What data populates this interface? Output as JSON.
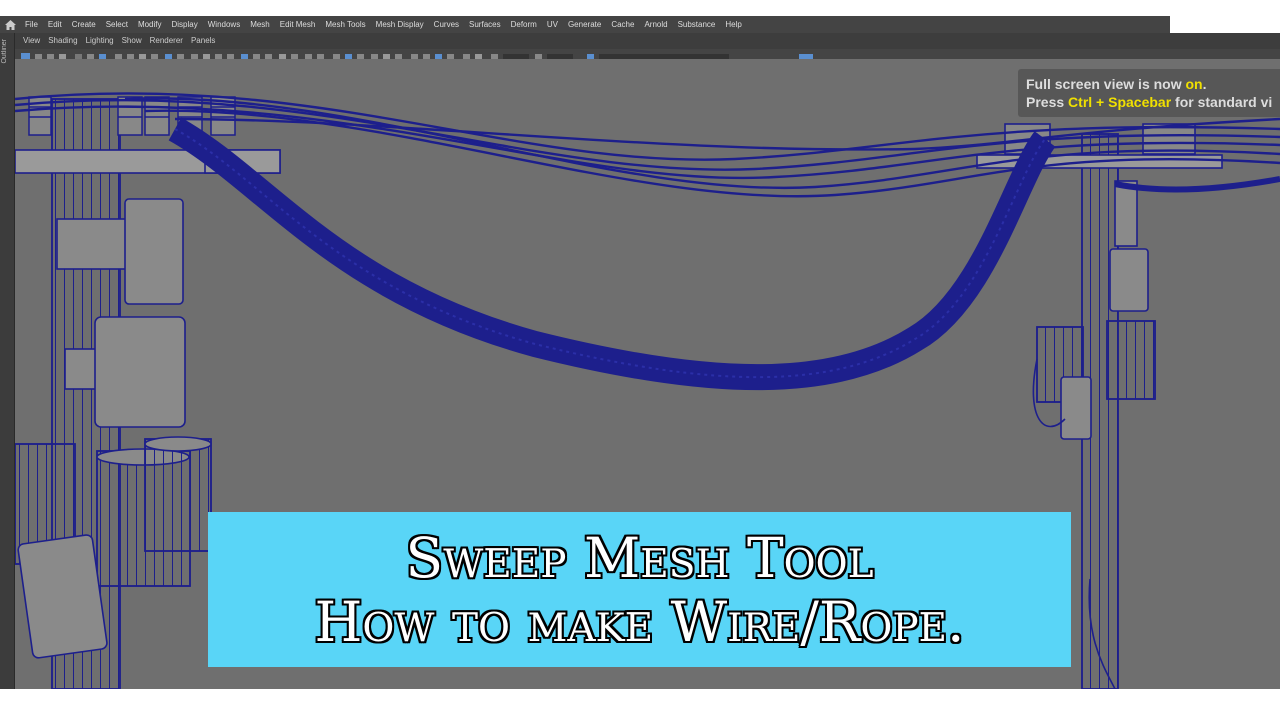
{
  "menubar": {
    "items": [
      "File",
      "Edit",
      "Create",
      "Select",
      "Modify",
      "Display",
      "Windows",
      "Mesh",
      "Edit Mesh",
      "Mesh Tools",
      "Mesh Display",
      "Curves",
      "Surfaces",
      "Deform",
      "UV",
      "Generate",
      "Cache",
      "Arnold",
      "Substance",
      "Help"
    ]
  },
  "panel_menu": {
    "items": [
      "View",
      "Shading",
      "Lighting",
      "Show",
      "Renderer",
      "Panels"
    ]
  },
  "outliner": {
    "label": "Outliner"
  },
  "hud": {
    "line1_prefix": "Full screen view is now ",
    "line1_highlight": "on",
    "line1_suffix": ".",
    "line2_prefix": "Press ",
    "line2_highlight": "Ctrl + Spacebar",
    "line2_suffix": " for standard vi"
  },
  "banner": {
    "line1": "Sweep Mesh Tool",
    "line2": "How to make Wire/Rope."
  },
  "colors": {
    "viewport_bg": "#6f6f6f",
    "wireframe": "#1d1f8c",
    "banner_bg": "#59d5f7",
    "hud_highlight": "#f0e000"
  }
}
